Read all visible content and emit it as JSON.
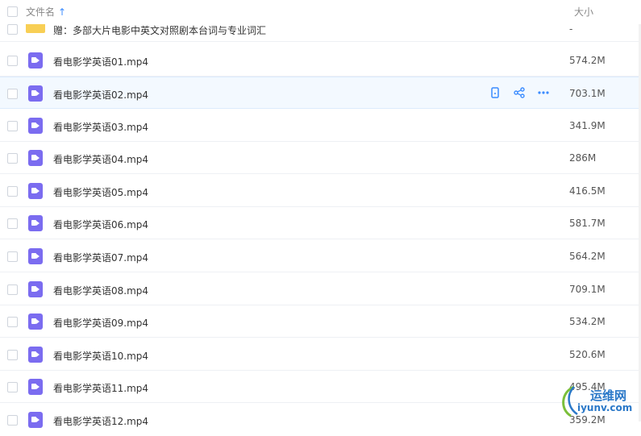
{
  "header": {
    "name_label": "文件名",
    "sort_icon": "sort-up-arrow",
    "size_label": "大小"
  },
  "files": [
    {
      "name": "赠：多部大片电影中英文对照剧本台词与专业词汇",
      "size": "-",
      "type": "folder"
    },
    {
      "name": "看电影学英语01.mp4",
      "size": "574.2M",
      "type": "video"
    },
    {
      "name": "看电影学英语02.mp4",
      "size": "703.1M",
      "type": "video"
    },
    {
      "name": "看电影学英语03.mp4",
      "size": "341.9M",
      "type": "video"
    },
    {
      "name": "看电影学英语04.mp4",
      "size": "286M",
      "type": "video"
    },
    {
      "name": "看电影学英语05.mp4",
      "size": "416.5M",
      "type": "video"
    },
    {
      "name": "看电影学英语06.mp4",
      "size": "581.7M",
      "type": "video"
    },
    {
      "name": "看电影学英语07.mp4",
      "size": "564.2M",
      "type": "video"
    },
    {
      "name": "看电影学英语08.mp4",
      "size": "709.1M",
      "type": "video"
    },
    {
      "name": "看电影学英语09.mp4",
      "size": "534.2M",
      "type": "video"
    },
    {
      "name": "看电影学英语10.mp4",
      "size": "520.6M",
      "type": "video"
    },
    {
      "name": "看电影学英语11.mp4",
      "size": "495.4M",
      "type": "video"
    },
    {
      "name": "看电影学英语12.mp4",
      "size": "359.2M",
      "type": "video"
    }
  ],
  "hover_actions": [
    {
      "icon": "phone-icon"
    },
    {
      "icon": "share-icon"
    },
    {
      "icon": "more-icon"
    }
  ],
  "watermark": {
    "cn": "运维网",
    "en": "iyunv.com"
  },
  "colors": {
    "accent": "#3b8cff",
    "video_icon": "#7b6cf0",
    "folder_icon": "#f8cf55",
    "hover_row": "#f3f9ff"
  }
}
